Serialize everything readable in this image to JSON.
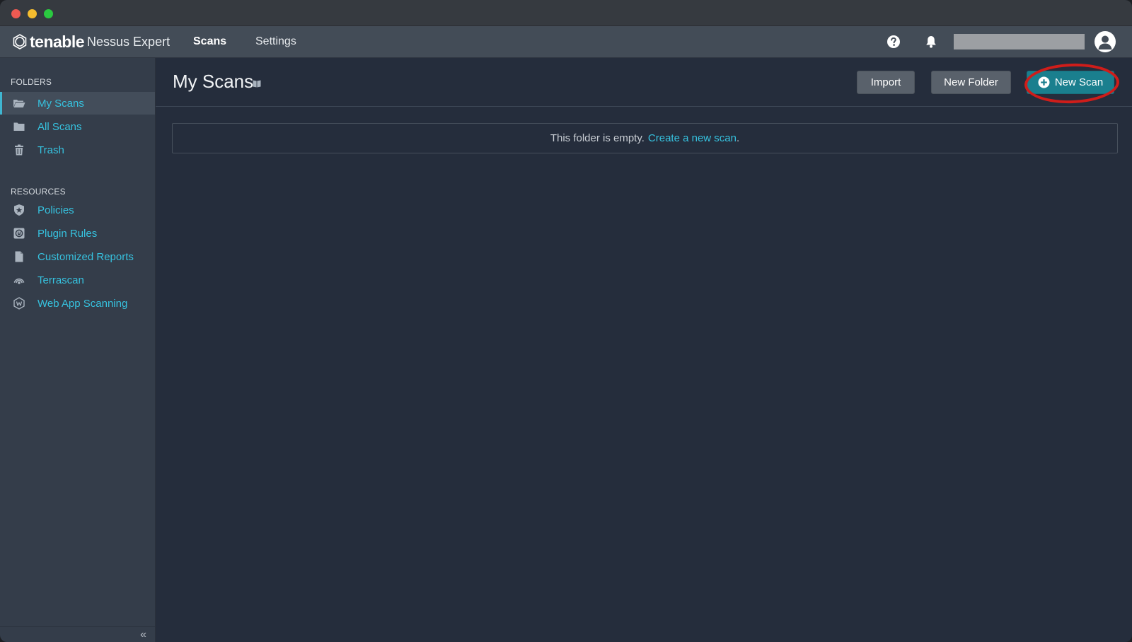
{
  "topnav": {
    "brand_name": "tenable",
    "brand_product": "Nessus Expert",
    "links": [
      {
        "label": "Scans",
        "active": true
      },
      {
        "label": "Settings",
        "active": false
      }
    ]
  },
  "sidebar": {
    "folders_label": "FOLDERS",
    "folders": [
      {
        "label": "My Scans",
        "icon": "folder-open-icon",
        "active": true
      },
      {
        "label": "All Scans",
        "icon": "folder-icon",
        "active": false
      },
      {
        "label": "Trash",
        "icon": "trash-icon",
        "active": false
      }
    ],
    "resources_label": "RESOURCES",
    "resources": [
      {
        "label": "Policies",
        "icon": "shield-star-icon"
      },
      {
        "label": "Plugin Rules",
        "icon": "plugin-icon"
      },
      {
        "label": "Customized Reports",
        "icon": "report-icon"
      },
      {
        "label": "Terrascan",
        "icon": "terrascan-icon"
      },
      {
        "label": "Web App Scanning",
        "icon": "web-app-icon"
      }
    ],
    "collapse_glyph": "«"
  },
  "main": {
    "title": "My Scans",
    "buttons": {
      "import": "Import",
      "new_folder": "New Folder",
      "new_scan": "New Scan"
    },
    "empty_message": "This folder is empty.",
    "empty_link": "Create a new scan",
    "empty_suffix": "."
  },
  "colors": {
    "accent": "#36c2df",
    "primary_button": "#1a7f8e",
    "highlight": "#cf1d1a"
  }
}
